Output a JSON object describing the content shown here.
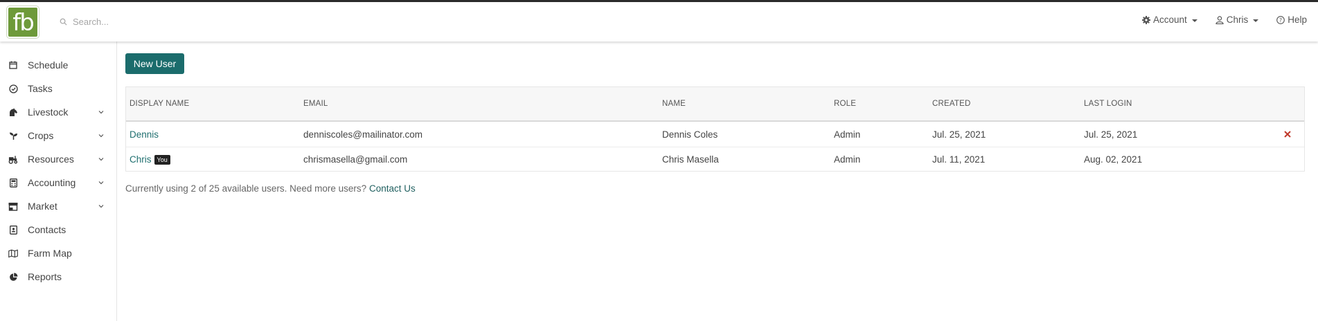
{
  "app": {
    "logo_text": "fb"
  },
  "search": {
    "placeholder": "Search..."
  },
  "topnav": {
    "account_label": "Account",
    "user_label": "Chris",
    "help_label": "Help"
  },
  "sidebar": {
    "items": [
      {
        "label": "Schedule",
        "icon": "calendar-icon",
        "expandable": false
      },
      {
        "label": "Tasks",
        "icon": "check-circle-icon",
        "expandable": false
      },
      {
        "label": "Livestock",
        "icon": "horse-icon",
        "expandable": true
      },
      {
        "label": "Crops",
        "icon": "seedling-icon",
        "expandable": true
      },
      {
        "label": "Resources",
        "icon": "tractor-icon",
        "expandable": true
      },
      {
        "label": "Accounting",
        "icon": "calculator-icon",
        "expandable": true
      },
      {
        "label": "Market",
        "icon": "store-icon",
        "expandable": true
      },
      {
        "label": "Contacts",
        "icon": "address-card-icon",
        "expandable": false
      },
      {
        "label": "Farm Map",
        "icon": "map-icon",
        "expandable": false
      },
      {
        "label": "Reports",
        "icon": "pie-chart-icon",
        "expandable": false
      }
    ]
  },
  "main": {
    "new_user_label": "New User",
    "table": {
      "headers": [
        "DISPLAY NAME",
        "EMAIL",
        "NAME",
        "ROLE",
        "CREATED",
        "LAST LOGIN"
      ],
      "rows": [
        {
          "display_name": "Dennis",
          "badge": "",
          "email": "denniscoles@mailinator.com",
          "name": "Dennis Coles",
          "role": "Admin",
          "created": "Jul. 25, 2021",
          "last_login": "Jul. 25, 2021",
          "deletable": true
        },
        {
          "display_name": "Chris",
          "badge": "You",
          "email": "chrismasella@gmail.com",
          "name": "Chris Masella",
          "role": "Admin",
          "created": "Jul. 11, 2021",
          "last_login": "Aug. 02, 2021",
          "deletable": false
        }
      ]
    },
    "footnote": {
      "text": "Currently using 2 of 25 available users. Need more users?",
      "link": "Contact Us"
    }
  },
  "colors": {
    "brand_green": "#6e9a3a",
    "teal": "#1b6c6c",
    "delete_red": "#c0392b"
  }
}
